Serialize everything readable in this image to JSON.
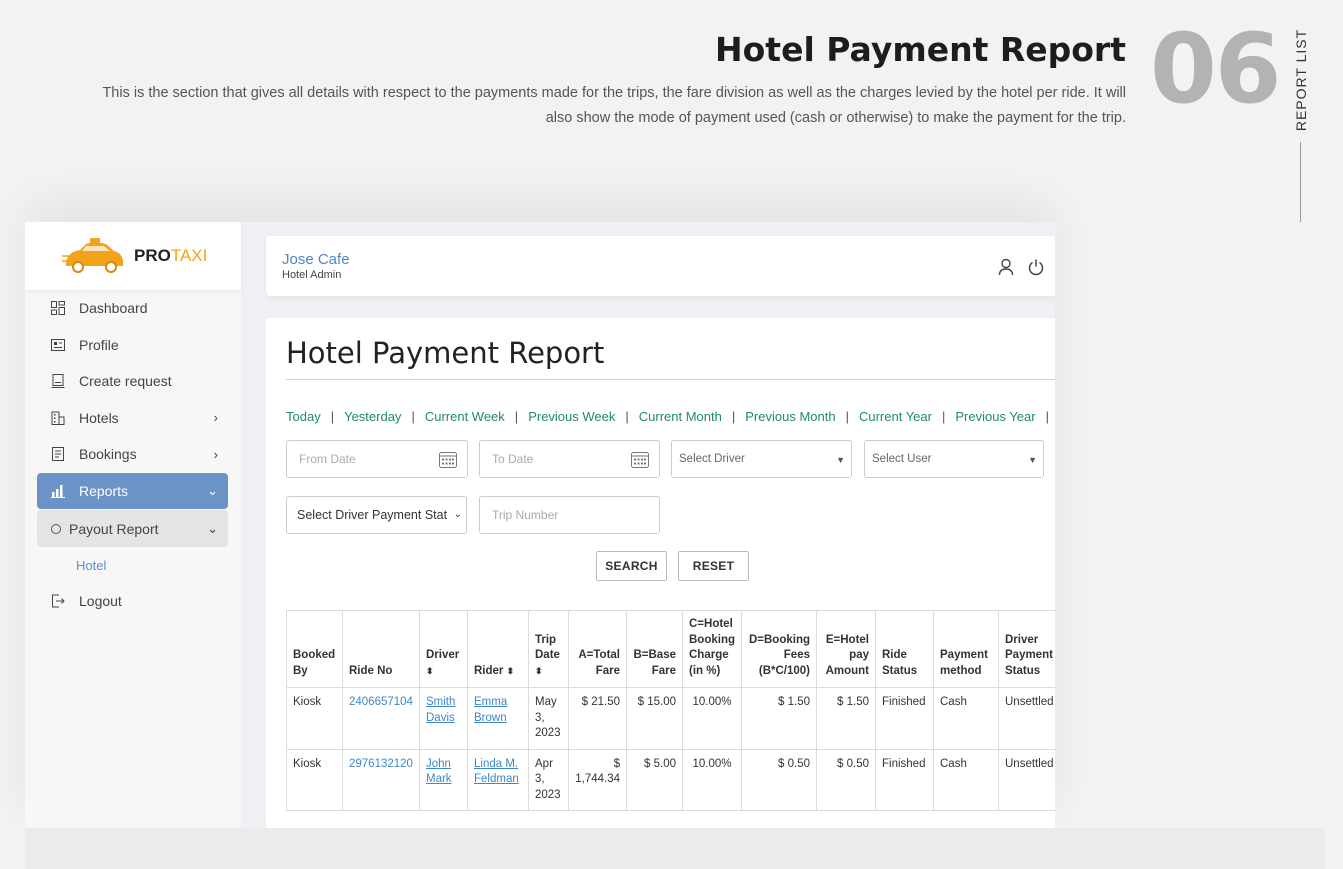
{
  "doc": {
    "title": "Hotel Payment Report",
    "description": "This is the section that gives all details with respect to the payments made for the trips, the fare division as well as the charges levied by the hotel per ride. It will also show the mode of payment used (cash or otherwise) to make the payment for the trip.",
    "number": "06",
    "section_label": "REPORT LIST"
  },
  "brand": {
    "pro": "PRO",
    "taxi": "TAXI",
    "accent": "#f2a21b"
  },
  "sidebar": {
    "items": [
      {
        "label": "Dashboard",
        "icon": "dashboard-icon"
      },
      {
        "label": "Profile",
        "icon": "profile-card-icon"
      },
      {
        "label": "Create request",
        "icon": "create-request-icon"
      },
      {
        "label": "Hotels",
        "icon": "hotel-building-icon",
        "arrow": "›"
      },
      {
        "label": "Bookings",
        "icon": "bookings-icon",
        "arrow": "›"
      },
      {
        "label": "Reports",
        "icon": "bar-chart-icon",
        "arrow": "⌄"
      }
    ],
    "sub_item": {
      "label": "Payout Report",
      "arrow": "⌄"
    },
    "sub_sub_item": "Hotel",
    "logout": "Logout"
  },
  "topbar": {
    "name": "Jose Cafe",
    "role": "Hotel Admin"
  },
  "report": {
    "title": "Hotel Payment Report",
    "quick_filters": [
      "Today",
      "Yesterday",
      "Current Week",
      "Previous Week",
      "Current Month",
      "Previous Month",
      "Current Year",
      "Previous Year"
    ],
    "from_date_placeholder": "From Date",
    "to_date_placeholder": "To Date",
    "driver_select": "Select Driver",
    "user_select": "Select User",
    "payment_status_select": "Select Driver Payment Stat",
    "trip_number_placeholder": "Trip Number",
    "search_label": "SEARCH",
    "reset_label": "RESET"
  },
  "table": {
    "headers": {
      "booked_by": "Booked By",
      "ride_no": "Ride No",
      "driver": "Driver",
      "rider": "Rider",
      "trip_date": "Trip Date",
      "total_fare": "A=Total Fare",
      "base_fare": "B=Base Fare",
      "booking_charge": "C=Hotel Booking Charge (in %)",
      "booking_fees": "D=Booking Fees (B*C/100)",
      "pay_amount": "E=Hotel pay Amount",
      "ride_status": "Ride Status",
      "payment_method": "Payment method",
      "driver_payment_status": "Driver Payment Status"
    },
    "rows": [
      {
        "booked_by": "Kiosk",
        "ride_no": "2406657104",
        "driver": "Smith Davis",
        "rider": "Emma Brown",
        "trip_date": "May 3, 2023",
        "total_fare": "$ 21.50",
        "base_fare": "$ 15.00",
        "booking_charge": "10.00%",
        "booking_fees": "$ 1.50",
        "pay_amount": "$ 1.50",
        "ride_status": "Finished",
        "payment_method": "Cash",
        "driver_payment_status": "Unsettled"
      },
      {
        "booked_by": "Kiosk",
        "ride_no": "2976132120",
        "driver": "John Mark",
        "rider": "Linda M. Feldman",
        "trip_date": "Apr 3, 2023",
        "total_fare": "$ 1,744.34",
        "base_fare": "$ 5.00",
        "booking_charge": "10.00%",
        "booking_fees": "$ 0.50",
        "pay_amount": "$ 0.50",
        "ride_status": "Finished",
        "payment_method": "Cash",
        "driver_payment_status": "Unsettled"
      }
    ]
  }
}
